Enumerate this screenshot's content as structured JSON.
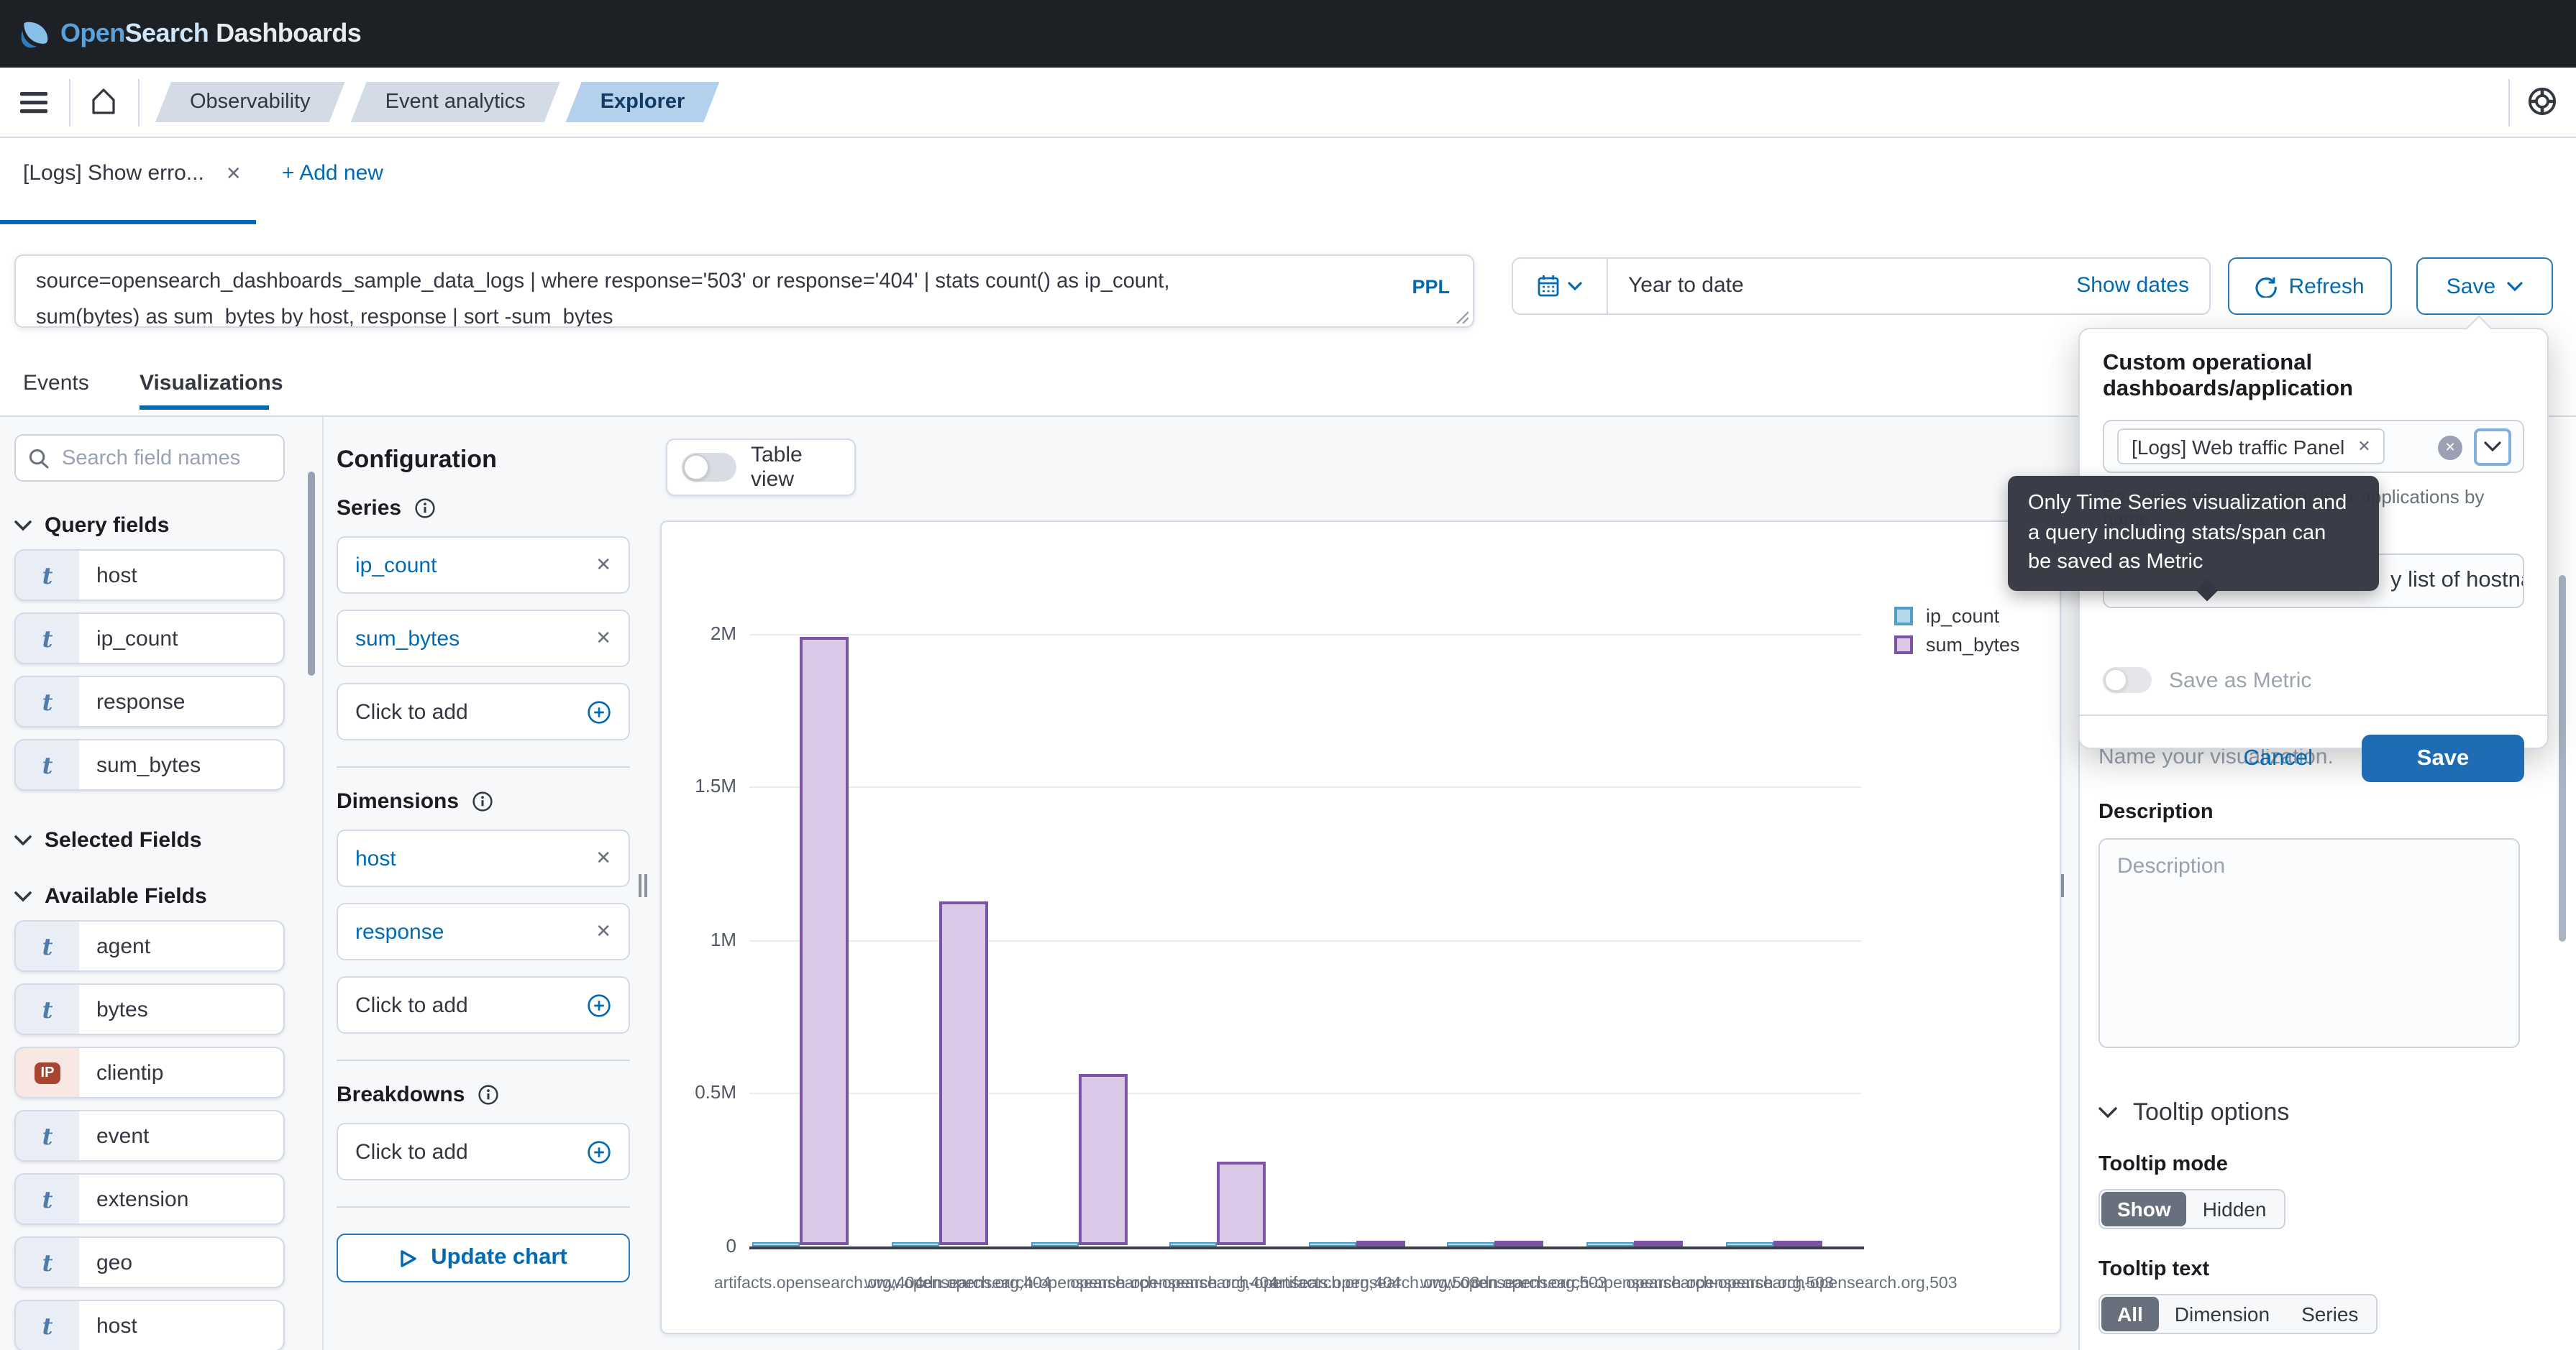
{
  "app": {
    "brand": {
      "open": "Open",
      "search": "Search",
      "dashboards": "Dashboards"
    }
  },
  "nav": {
    "breadcrumbs": [
      {
        "label": "Observability",
        "active": false
      },
      {
        "label": "Event analytics",
        "active": false
      },
      {
        "label": "Explorer",
        "active": true
      }
    ]
  },
  "tabs": {
    "active_tab": "[Logs] Show erro...",
    "add_new": "+ Add new"
  },
  "query": {
    "line1": "source=opensearch_dashboards_sample_data_logs | where response='503' or response='404' |    stats count() as ip_count,",
    "line2": "sum(bytes)    as sum_bytes by host, response | sort -sum_bytes",
    "language": "PPL"
  },
  "timebar": {
    "range": "Year to date",
    "show_dates": "Show dates",
    "refresh": "Refresh",
    "save": "Save"
  },
  "view_tabs": {
    "events": "Events",
    "visualizations": "Visualizations"
  },
  "sidebar": {
    "search_placeholder": "Search field names",
    "query_fields_label": "Query fields",
    "selected_fields_label": "Selected Fields",
    "available_fields_label": "Available Fields",
    "query_fields": [
      {
        "type": "t",
        "name": "host"
      },
      {
        "type": "t",
        "name": "ip_count"
      },
      {
        "type": "t",
        "name": "response"
      },
      {
        "type": "t",
        "name": "sum_bytes"
      }
    ],
    "available_fields": [
      {
        "type": "t",
        "name": "agent"
      },
      {
        "type": "t",
        "name": "bytes"
      },
      {
        "type": "ip",
        "name": "clientip"
      },
      {
        "type": "t",
        "name": "event"
      },
      {
        "type": "t",
        "name": "extension"
      },
      {
        "type": "t",
        "name": "geo"
      },
      {
        "type": "t",
        "name": "host"
      }
    ]
  },
  "config": {
    "title": "Configuration",
    "click_to_add": "Click to add",
    "update_chart": "Update chart",
    "groups": [
      {
        "label": "Series",
        "items": [
          "ip_count",
          "sum_bytes"
        ]
      },
      {
        "label": "Dimensions",
        "items": [
          "host",
          "response"
        ]
      },
      {
        "label": "Breakdowns",
        "items": []
      }
    ]
  },
  "chart_panel": {
    "table_view_label": "Table view"
  },
  "chart_data": {
    "type": "bar",
    "title": "",
    "xlabel": "",
    "ylabel": "",
    "categories": [
      "artifacts.opensearch.org,404",
      "www.opensearch.org,404",
      "cdn.opensearch-opensearch-opensearch.org,404",
      "opensearch-opensearch-opensearch.org,404",
      "artifacts.opensearch.org,503",
      "www.opensearch.org,503",
      "cdn.opensearch-opensearch-opensearch.org,503",
      "opensearch-opensearch-opensearch.org,503"
    ],
    "series": [
      {
        "name": "ip_count",
        "values": [
          1500,
          1100,
          800,
          600,
          450,
          350,
          280,
          220
        ]
      },
      {
        "name": "sum_bytes",
        "values": [
          1990000,
          1125000,
          560000,
          273000,
          16000,
          13000,
          11000,
          9000
        ]
      }
    ],
    "ylim": [
      0,
      2000000
    ],
    "yticks": [
      {
        "v": 0,
        "label": "0"
      },
      {
        "v": 500000,
        "label": "0.5M"
      },
      {
        "v": 1000000,
        "label": "1M"
      },
      {
        "v": 1500000,
        "label": "1.5M"
      },
      {
        "v": 2000000,
        "label": "2M"
      }
    ],
    "grid": "horizontal",
    "legend_position": "top-right"
  },
  "save_popover": {
    "title": "Custom operational dashboards/application",
    "selected_panel": "[Logs] Web traffic Panel",
    "helper": "Search existing dashboards or applications by name",
    "name_value_visible": "y list of hostna",
    "save_as_metric_label": "Save as Metric",
    "cancel": "Cancel",
    "save": "Save"
  },
  "metric_tooltip": {
    "lines": [
      "Only Time Series visualization and",
      "a query including stats/span can",
      "be saved as Metric"
    ]
  },
  "right_panel": {
    "name_helper": "Name your visualization.",
    "description_label": "Description",
    "description_placeholder": "Description",
    "tooltip_options_label": "Tooltip options",
    "tooltip_mode_label": "Tooltip mode",
    "tooltip_mode": {
      "options": [
        "Show",
        "Hidden"
      ],
      "selected": "Show"
    },
    "tooltip_text_label": "Tooltip text",
    "tooltip_text": {
      "options": [
        "All",
        "Dimension",
        "Series"
      ],
      "selected": "All"
    }
  },
  "colors": {
    "primary": "#006BB4",
    "ip_count_fill": "#b5d9ea",
    "ip_count_border": "#4d9fc4",
    "sum_bytes_fill": "#dbc7e6",
    "sum_bytes_border": "#7d53a3",
    "tooltip_bg": "#343741",
    "selected_segment": "#69707d"
  }
}
